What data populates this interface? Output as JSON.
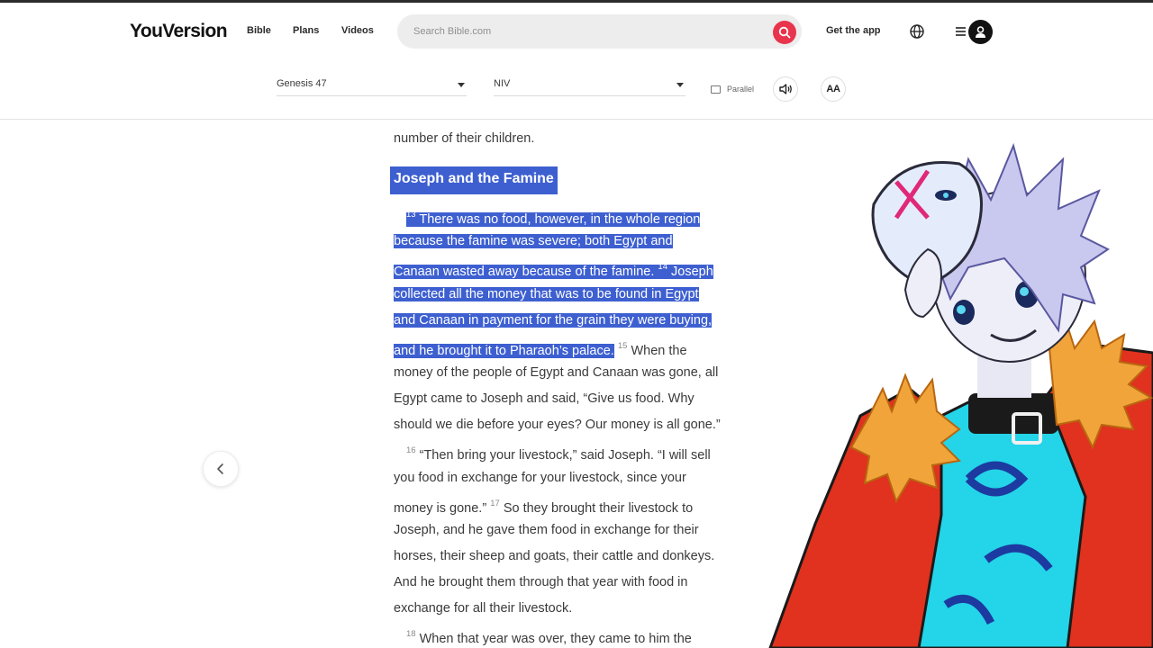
{
  "header": {
    "logo": "YouVersion",
    "nav": {
      "bible": "Bible",
      "plans": "Plans",
      "videos": "Videos"
    },
    "search_placeholder": "Search Bible.com",
    "get_app": "Get the app"
  },
  "toolbar": {
    "book": "Genesis 47",
    "version": "NIV",
    "parallel": "Parallel",
    "font_size": "AA"
  },
  "reader": {
    "line_prev": "number of their children.",
    "heading": "Joseph and the Famine",
    "v13": "13",
    "l1": "There was no food, however, in the whole region",
    "l2": "because the famine was severe; both Egypt and",
    "l3a": "Canaan wasted away because of the famine.",
    "v14": "14",
    "l3b": "Joseph",
    "l4": "collected all the money that was to be found in Egypt",
    "l5": "and Canaan in payment for the grain they were buying,",
    "l6a": "and he brought it to Pharaoh’s palace.",
    "v15": "15",
    "l6b": "When the",
    "l7": "money of the people of Egypt and Canaan was gone, all",
    "l8": "Egypt came to Joseph and said, “Give us food. Why",
    "l9": "should we die before your eyes? Our money is all gone.”",
    "v16": "16",
    "l10": "“Then bring your livestock,” said Joseph. “I will sell",
    "l11": "you food in exchange for your livestock, since your",
    "l12a": "money is gone.”",
    "v17": "17",
    "l12b": "So they brought their livestock to",
    "l13": "Joseph, and he gave them food in exchange for their",
    "l14": "horses, their sheep and goats, their cattle and donkeys.",
    "l15": "And he brought them through that year with food in",
    "l16": "exchange for all their livestock.",
    "v18": "18",
    "l17": "When that year was over, they came to him the"
  },
  "colors": {
    "highlight": "#3d5fd0",
    "search_accent": "#e8344c",
    "jacket": "#e0321e",
    "shirt": "#22d3e6"
  },
  "icons": {
    "search": "search-icon",
    "globe": "globe-icon",
    "menu": "menu-icon",
    "avatar": "user-icon",
    "audio": "speaker-icon",
    "parallel": "parallel-icon",
    "prev": "chevron-left-icon"
  }
}
